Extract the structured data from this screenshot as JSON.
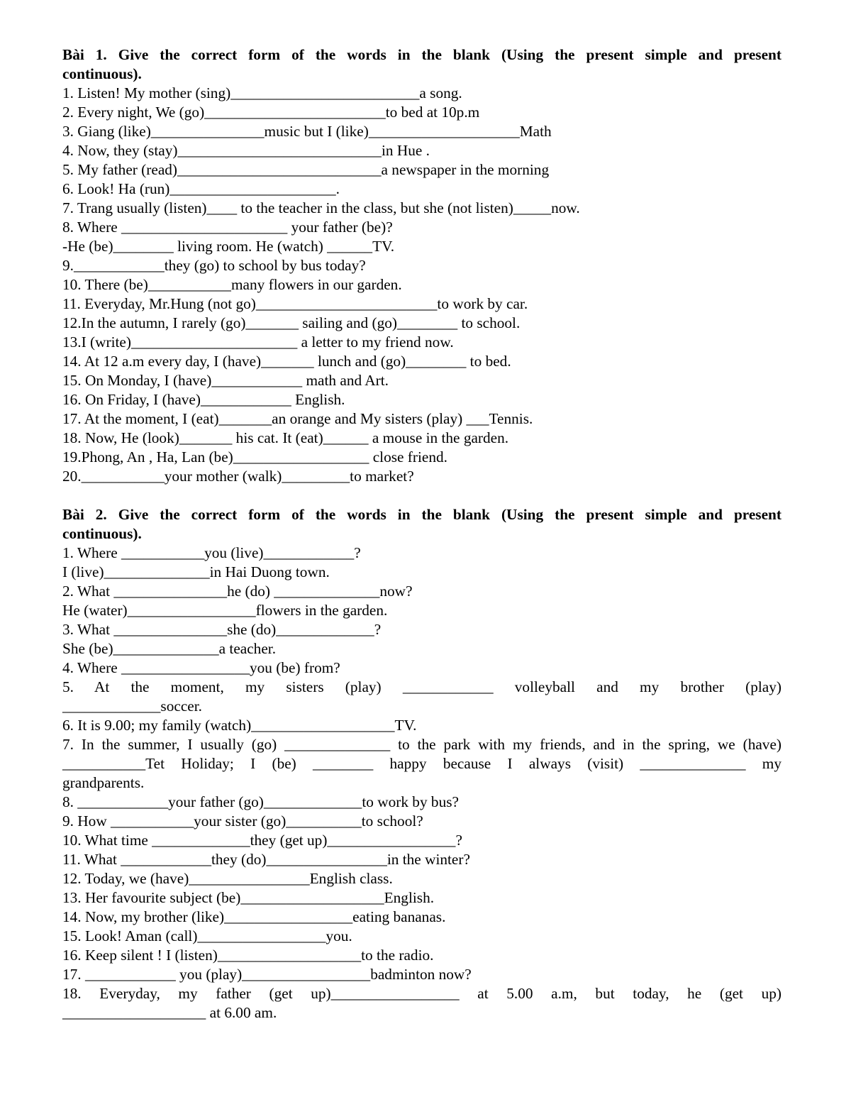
{
  "exercise1": {
    "title_line1": "Bài 1. Give the correct form of the words in the blank (Using the present simple and present",
    "title_line2": "continuous).",
    "lines": [
      "1. Listen! My mother (sing)_________________________a song.",
      "2. Every night, We (go)________________________to bed at 10p.m",
      "3. Giang (like)_______________music but I (like)____________________Math",
      "4. Now, they (stay)___________________________in Hue .",
      "5. My father (read)___________________________a newspaper in the morning",
      "6. Look! Ha (run)______________________.",
      "7. Trang usually (listen)____ to the teacher in the class, but she (not listen)_____now.",
      "8. Where ______________________ your father (be)?",
      "-He (be)________ living room. He (watch) ______TV.",
      "9.____________they (go) to school by bus today?",
      "10. There (be)___________many flowers in our garden.",
      "11. Everyday, Mr.Hung (not go)________________________to work by car.",
      "12.In the autumn, I rarely (go)_______ sailing and (go)________ to school.",
      "13.I (write)______________________ a letter to my friend now.",
      "14. At 12 a.m every day, I (have)_______ lunch and (go)________ to bed.",
      "15. On Monday, I (have)____________ math and Art.",
      "16. On Friday, I (have)____________ English.",
      "17. At the moment, I (eat)_______an orange and My sisters (play) ___Tennis.",
      "18. Now, He (look)_______ his cat. It (eat)______ a mouse in the garden.",
      "19.Phong, An , Ha, Lan (be)__________________ close friend.",
      "20.___________your mother (walk)_________to market?"
    ]
  },
  "exercise2": {
    "title_line1": "Bài 2. Give the correct form of the words in the blank (Using the present simple and present",
    "title_line2": "continuous).",
    "lines_a": [
      "1. Where ___________you (live)____________?",
      "I (live)______________in Hai Duong town.",
      "2. What _______________he (do) ______________now?",
      "He (water)_________________flowers in the garden.",
      "3. What _______________she (do)_____________?",
      "She (be)______________a teacher.",
      "4. Where _________________you (be) from?"
    ],
    "item5_line1": "5. At the moment, my sisters (play) ____________ volleyball and my brother (play)",
    "item5_line2": "_____________soccer.",
    "item6": "6. It is 9.00; my family (watch)___________________TV.",
    "item7_line1": "7. In the summer, I usually (go) ______________ to the park with my friends, and in the spring, we (have)",
    "item7_line2": "___________Tet Holiday; I (be) ________ happy because I always (visit) ______________ my",
    "item7_line3": "grandparents.",
    "lines_b": [
      "8. ____________your father (go)_____________to work by bus?",
      "9. How ___________your sister (go)__________to school?",
      "10. What time _____________they (get up)_________________?",
      "11. What ____________they (do)________________in the winter?",
      "12. Today, we (have)________________English class.",
      "13. Her favourite subject (be)___________________English.",
      "14. Now, my brother (like)_________________eating bananas.",
      "15. Look! Aman (call)_________________you.",
      "16. Keep silent ! I (listen)___________________to the radio.",
      "17. ____________ you (play)_________________badminton now?"
    ],
    "item18_line1": "18. Everyday, my father (get up)_________________ at 5.00 a.m, but today, he (get up)",
    "item18_line2": "___________________ at 6.00 am."
  }
}
